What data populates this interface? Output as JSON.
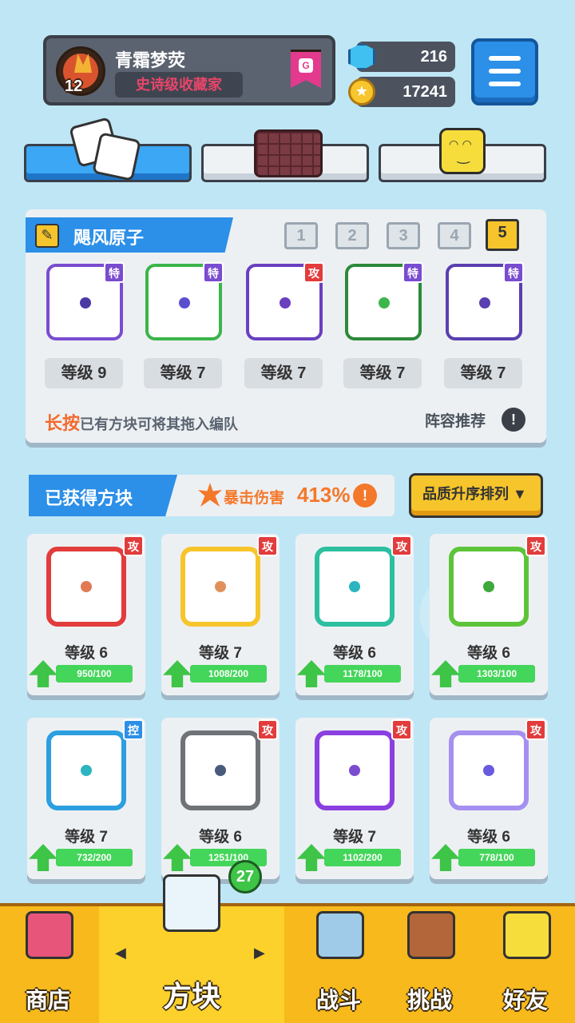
{
  "profile": {
    "player_name": "青霜梦荧",
    "title": "史诗级收藏家",
    "avatar_level": "12",
    "rank_letter": "G"
  },
  "currency": {
    "gems": "216",
    "coins": "17241"
  },
  "team": {
    "name": "飓风原子",
    "slots": [
      "1",
      "2",
      "3",
      "4",
      "5"
    ],
    "active_slot": "5",
    "blocks": [
      {
        "badge": "特",
        "level": "等级 9",
        "border": "#7a4cd0",
        "dot": "#4a3aa5",
        "badge_color": "#7a4cd0"
      },
      {
        "badge": "特",
        "level": "等级 7",
        "border": "#3cb54a",
        "dot": "#5a4fd0",
        "badge_color": "#7a4cd0"
      },
      {
        "badge": "攻",
        "level": "等级 7",
        "border": "#6a3fc0",
        "dot": "#6a3fc0",
        "badge_color": "#e23c3c"
      },
      {
        "badge": "特",
        "level": "等级 7",
        "border": "#2c8a3a",
        "dot": "#3cb54a",
        "badge_color": "#7a4cd0"
      },
      {
        "badge": "特",
        "level": "等级 7",
        "border": "#5a3fb0",
        "dot": "#5a3fb0",
        "badge_color": "#7a4cd0"
      }
    ],
    "hint_bold": "长按",
    "hint_rest": "已有方块可将其拖入编队",
    "recommend": "阵容推荐",
    "recommend_icon": "!"
  },
  "collection": {
    "title": "已获得方块",
    "crit_label": "暴击伤害",
    "crit_value": "413%",
    "crit_info": "!",
    "sort_label": "品质升序排列 ▼",
    "cards": [
      {
        "badge": "攻",
        "badge_color": "#e23c3c",
        "border": "#e23c3c",
        "dot": "#e07a55",
        "level": "等级 6",
        "progress": "950/100",
        "fill": 1.0
      },
      {
        "badge": "攻",
        "badge_color": "#e23c3c",
        "border": "#f6c52c",
        "dot": "#e0915a",
        "level": "等级 7",
        "progress": "1008/200",
        "fill": 1.0
      },
      {
        "badge": "攻",
        "badge_color": "#e23c3c",
        "border": "#2cbfa0",
        "dot": "#2cb5c0",
        "level": "等级 6",
        "progress": "1178/100",
        "fill": 1.0
      },
      {
        "badge": "攻",
        "badge_color": "#e23c3c",
        "border": "#5dc43a",
        "dot": "#3ea83a",
        "level": "等级 6",
        "progress": "1303/100",
        "fill": 1.0
      },
      {
        "badge": "控",
        "badge_color": "#2c8fe8",
        "border": "#2c9fe0",
        "dot": "#2cb5c0",
        "level": "等级 7",
        "progress": "732/200",
        "fill": 1.0
      },
      {
        "badge": "攻",
        "badge_color": "#e23c3c",
        "border": "#6f7378",
        "dot": "#4a5a7a",
        "level": "等级 6",
        "progress": "1251/100",
        "fill": 1.0
      },
      {
        "badge": "攻",
        "badge_color": "#e23c3c",
        "border": "#8a3fe0",
        "dot": "#7a4cd0",
        "level": "等级 7",
        "progress": "1102/200",
        "fill": 1.0
      },
      {
        "badge": "攻",
        "badge_color": "#e23c3c",
        "border": "#a590f0",
        "dot": "#6a5ae0",
        "level": "等级 6",
        "progress": "778/100",
        "fill": 1.0
      }
    ]
  },
  "nav": {
    "items": [
      {
        "label": "商店",
        "icon": "shop-icon"
      },
      {
        "label": "方块",
        "icon": "block-icon"
      },
      {
        "label": "战斗",
        "icon": "battle-icon"
      },
      {
        "label": "挑战",
        "icon": "challenge-icon"
      },
      {
        "label": "好友",
        "icon": "friends-icon"
      }
    ],
    "block_count": "27",
    "arrow_left": "◀",
    "arrow_right": "▶"
  }
}
